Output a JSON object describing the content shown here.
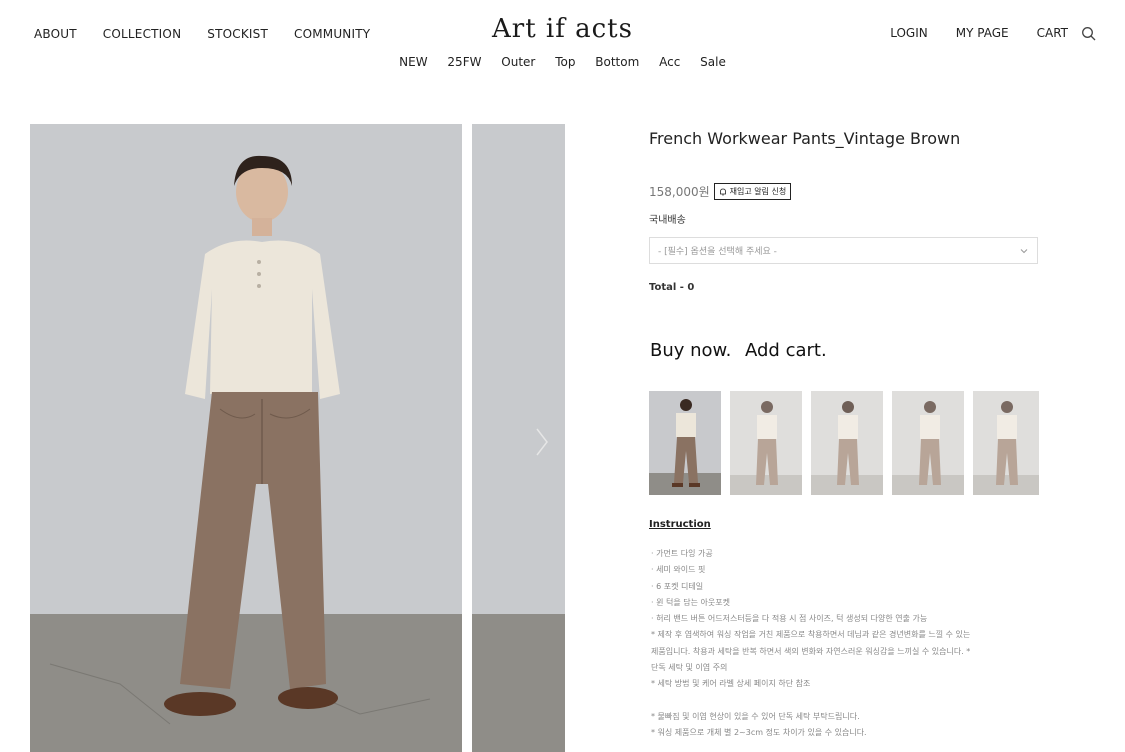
{
  "header": {
    "logo": "Art if acts",
    "nav_left": [
      "ABOUT",
      "COLLECTION",
      "STOCKIST",
      "COMMUNITY"
    ],
    "nav_right": [
      "LOGIN",
      "MY PAGE",
      "CART"
    ],
    "categories": [
      "NEW",
      "25FW",
      "Outer",
      "Top",
      "Bottom",
      "Acc",
      "Sale"
    ]
  },
  "product": {
    "title": "French Workwear Pants_Vintage Brown",
    "price": "158,000원",
    "restock_label": "재입고 알림 신청",
    "shipping": "국내배송",
    "option_placeholder": "- [필수] 옵션을 선택해 주세요 -",
    "total": "Total - 0",
    "buy_label": "Buy now.",
    "cart_label": "Add cart."
  },
  "instruction": {
    "title": "Instruction",
    "lines": [
      "· 가먼트 다잉 가공",
      "· 세미 와이드 핏",
      "· 6 포켓 디테일",
      "· 윈 턱을 담는 아웃포켓",
      "· 허리 밴드 버튼 어드저스터등을 다 적용 시 점 사이즈, 턱 생성되 다양한 연출 가능",
      "* 제작 후 염색하여 워싱 작업을 거친 제품으로 착용하면서 데님과 같은 경년변화를 느낄 수 있는",
      "제품입니다. 착용과 세탁을 반복 하면서 색의 변화와 자연스러운 워싱감을 느끼실 수 있습니다. *",
      "단독 세탁 및 이염 주의",
      "* 세탁 방법 및 케어 라벨 상세 페이지 하단 참조",
      "",
      "* 물빠짐 및 이염 현상이 있을 수 있어 단독 세탁 부탁드립니다.",
      "* 워싱 제품으로 개체 별 2~3cm 정도 차이가 있을 수 있습니다."
    ]
  },
  "colors": {
    "backdrop": "#c9cbce",
    "floor": "#8c8a85",
    "shirt": "#ece6da",
    "pants": "#8a7262",
    "shoes": "#5a3826"
  },
  "icons": [
    "search-icon",
    "bell-icon",
    "chevron-down-icon"
  ]
}
